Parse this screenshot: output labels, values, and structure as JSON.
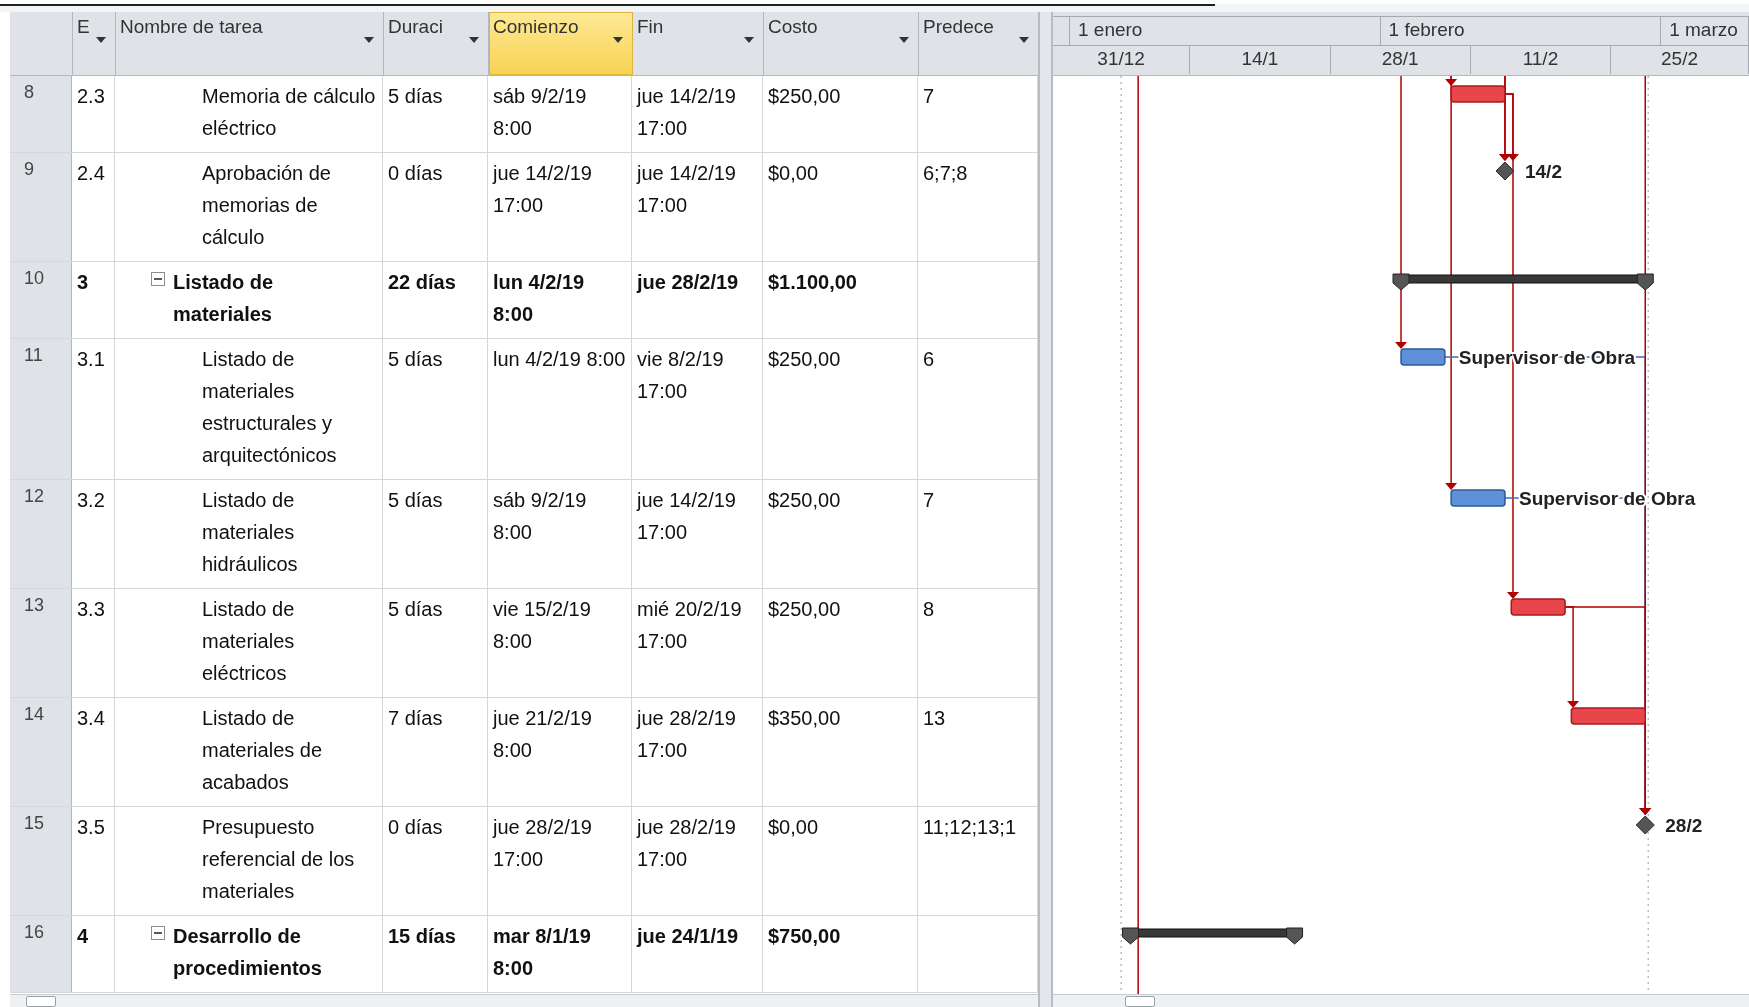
{
  "columns": [
    {
      "label": "E",
      "selected": false
    },
    {
      "label": "Nombre de tarea",
      "selected": false
    },
    {
      "label": "Duraci",
      "selected": false
    },
    {
      "label": "Comienzo",
      "selected": true
    },
    {
      "label": "Fin",
      "selected": false
    },
    {
      "label": "Costo",
      "selected": false
    },
    {
      "label": "Predece",
      "selected": false
    }
  ],
  "timescale": {
    "major": [
      "1 enero",
      "1 febrero",
      "1 marzo"
    ],
    "minor": [
      "31/12",
      "14/1",
      "28/1",
      "11/2",
      "25/2"
    ]
  },
  "rows": [
    {
      "kind": "group",
      "children": [
        {
          "kind": "critical",
          "id": "8",
          "wbs": "2.3",
          "name": "Memoria de cálculo eléctrico",
          "duration": "5 días",
          "start": "sáb 9/2/19 8:00",
          "finish": "jue 14/2/19 17:00",
          "cost": "$250,00",
          "predecessors": "7"
        },
        {
          "kind": "milestone",
          "id": "9",
          "wbs": "2.4",
          "name": "Aprobación de memorias de cálculo",
          "duration": "0 días",
          "start": "jue 14/2/19 17:00",
          "finish": "jue 14/2/19 17:00",
          "cost": "$0,00",
          "predecessors": "6;7;8",
          "bar_label": "14/2"
        }
      ]
    },
    {
      "kind": "summary",
      "expanded": true,
      "id": "10",
      "wbs": "3",
      "name": "Listado de materiales",
      "duration": "22 días",
      "start": "lun 4/2/19 8:00",
      "finish": "jue 28/2/19",
      "cost": "$1.100,00",
      "children": [
        {
          "kind": "task",
          "id": "11",
          "wbs": "3.1",
          "name": "Listado de materiales estructurales y arquitectónicos",
          "duration": "5 días",
          "start": "lun 4/2/19 8:00",
          "finish": "vie 8/2/19 17:00",
          "cost": "$250,00",
          "predecessors": "6",
          "bar_label": "Supervisor de Obra"
        },
        {
          "kind": "task",
          "id": "12",
          "wbs": "3.2",
          "name": "Listado de materiales hidráulicos",
          "duration": "5 días",
          "start": "sáb 9/2/19 8:00",
          "finish": "jue 14/2/19 17:00",
          "cost": "$250,00",
          "predecessors": "7",
          "bar_label": "Supervisor de Obra"
        },
        {
          "kind": "critical",
          "id": "13",
          "wbs": "3.3",
          "name": "Listado de materiales eléctricos",
          "duration": "5 días",
          "start": "vie 15/2/19 8:00",
          "finish": "mié 20/2/19 17:00",
          "cost": "$250,00",
          "predecessors": "8"
        },
        {
          "kind": "critical",
          "id": "14",
          "wbs": "3.4",
          "name": "Listado de materiales de acabados",
          "duration": "7 días",
          "start": "jue 21/2/19 8:00",
          "finish": "jue 28/2/19 17:00",
          "cost": "$350,00",
          "predecessors": "13"
        },
        {
          "kind": "milestone",
          "id": "15",
          "wbs": "3.5",
          "name": "Presupuesto referencial de los materiales",
          "duration": "0 días",
          "start": "jue 28/2/19 17:00",
          "finish": "jue 28/2/19 17:00",
          "cost": "$0,00",
          "predecessors": "11;12;13;1",
          "bar_label": "28/2"
        }
      ]
    },
    {
      "kind": "summary",
      "expanded": true,
      "id": "16",
      "wbs": "4",
      "name": "Desarrollo de procedimientos",
      "duration": "15 días",
      "start": "mar 8/1/19 8:00",
      "finish": "jue 24/1/19",
      "cost": "$750,00"
    }
  ]
}
